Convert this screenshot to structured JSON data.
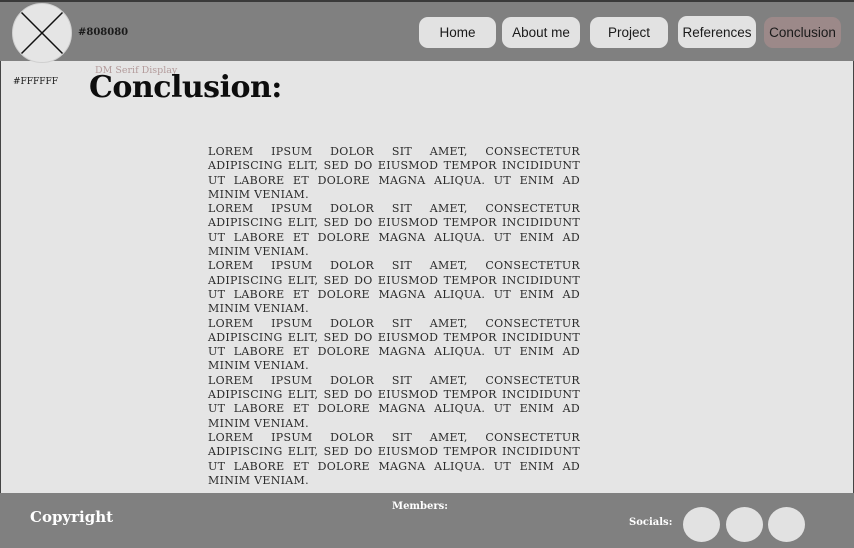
{
  "header": {
    "color_note": "#808080",
    "nav": [
      {
        "label": "Home"
      },
      {
        "label": "About me"
      },
      {
        "label": "Project"
      },
      {
        "label": "References"
      },
      {
        "label": "Conclusion"
      }
    ],
    "active": "Conclusion"
  },
  "main": {
    "background_note": "#FFFFFF",
    "font_note": "DM Serif Display",
    "title": "Conclusion:",
    "paragraphs": [
      "Lorem ipsum dolor sit amet, consectetur adipiscing elit, sed do eiusmod tempor incididunt ut labore et dolore magna aliqua. Ut enim ad minim veniam.",
      "Lorem ipsum dolor sit amet, consectetur adipiscing elit, sed do eiusmod tempor incididunt ut labore et dolore magna aliqua. Ut enim ad minim veniam.",
      "Lorem ipsum dolor sit amet, consectetur adipiscing elit, sed do eiusmod tempor incididunt ut labore et dolore magna aliqua. Ut enim ad minim veniam.",
      "Lorem ipsum dolor sit amet, consectetur adipiscing elit, sed do eiusmod tempor incididunt ut labore et dolore magna aliqua. Ut enim ad minim veniam.",
      "Lorem ipsum dolor sit amet, consectetur adipiscing elit, sed do eiusmod tempor incididunt ut labore et dolore magna aliqua. Ut enim ad minim veniam.",
      "Lorem ipsum dolor sit amet, consectetur adipiscing elit, sed do eiusmod tempor incididunt ut labore et dolore magna aliqua. Ut enim ad minim veniam."
    ]
  },
  "footer": {
    "copyright": "Copyright",
    "members_label": "Members:",
    "socials_label": "Socials:",
    "social_icons": [
      "social-icon",
      "social-icon",
      "social-icon"
    ]
  },
  "colors": {
    "header_bg": "#808080",
    "page_bg": "#e5e5e5",
    "button_bg": "#e2e2e2",
    "active_button_bg": "#9c8989"
  }
}
